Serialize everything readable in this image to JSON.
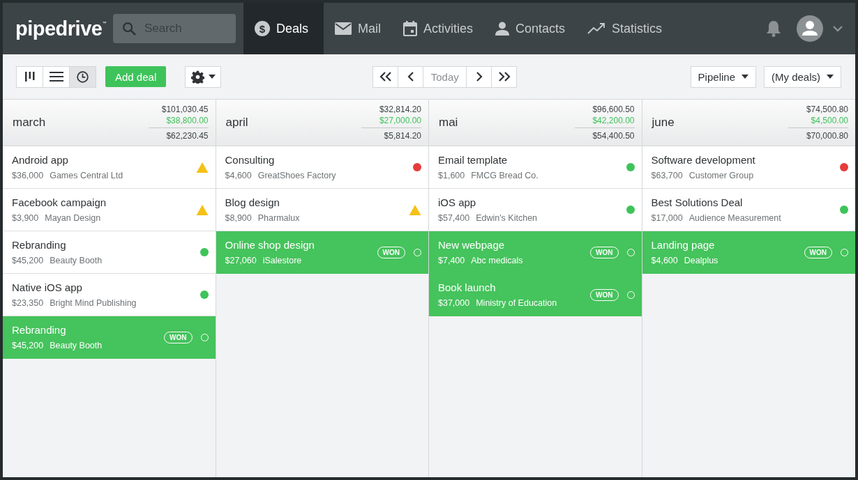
{
  "logo": "pipedrive$^{™}$",
  "search": {
    "placeholder": "Search"
  },
  "nav": [
    {
      "label": "Deals",
      "glyph": "$",
      "selected": true
    },
    {
      "label": "Mail",
      "selected": false
    },
    {
      "label": "Activities",
      "selected": false
    },
    {
      "label": "Contacts",
      "selected": false
    },
    {
      "label": "Statistics",
      "selected": false
    }
  ],
  "view_buttons": [
    {
      "selected": false
    },
    {
      "selected": false
    },
    {
      "selected": true
    }
  ],
  "add_button": "Add deal",
  "period_nav": {
    "today": "Today"
  },
  "filters": [
    {
      "label": "Pipeline"
    },
    {
      "label": "(My deals)"
    }
  ],
  "columns": [
    {
      "title": "march",
      "total": "$101,030.45",
      "won": "$38,800.00",
      "remaining": "$62,230.45",
      "deals": [
        {
          "name": "Android app",
          "value": "$36,000",
          "org": "Games Central Ltd",
          "kind": "warning"
        },
        {
          "name": "Facebook campaign",
          "value": "$3,900",
          "org": "Mayan Design",
          "kind": "warning"
        },
        {
          "name": "Rebranding",
          "value": "$45,200",
          "org": "Beauty Booth",
          "kind": "dot",
          "color": "#3ec35a"
        },
        {
          "name": "Native iOS app",
          "value": "$23,350",
          "org": "Bright Mind Publishing",
          "kind": "dot",
          "color": "#3ec35a"
        },
        {
          "name": "Rebranding",
          "value": "$45,200",
          "org": "Beauty Booth",
          "kind": "won",
          "badge": "WON"
        }
      ]
    },
    {
      "title": "april",
      "total": "$32,814.20",
      "won": "$27,000.00",
      "remaining": "$5,814.20",
      "deals": [
        {
          "name": "Consulting",
          "value": "$4,600",
          "org": "GreatShoes Factory",
          "kind": "dot",
          "color": "#e53c3c"
        },
        {
          "name": "Blog design",
          "value": "$8,900",
          "org": "Pharmalux",
          "kind": "warning"
        },
        {
          "name": "Online shop design",
          "value": "$27,060",
          "org": "iSalestore",
          "kind": "won",
          "badge": "WON"
        }
      ]
    },
    {
      "title": "mai",
      "total": "$96,600.50",
      "won": "$42,200.00",
      "remaining": "$54,400.50",
      "deals": [
        {
          "name": "Email template",
          "value": "$1,600",
          "org": "FMCG Bread Co.",
          "kind": "dot",
          "color": "#3ec35a"
        },
        {
          "name": "iOS app",
          "value": "$57,400",
          "org": "Edwin's Kitchen",
          "kind": "dot",
          "color": "#3ec35a"
        },
        {
          "name": "New webpage",
          "value": "$7,400",
          "org": "Abc medicals",
          "kind": "won",
          "badge": "WON"
        },
        {
          "name": "Book launch",
          "value": "$37,000",
          "org": "Ministry of Education",
          "kind": "won",
          "badge": "WON"
        }
      ]
    },
    {
      "title": "june",
      "total": "$74,500.80",
      "won": "$4,500.00",
      "remaining": "$70,000.80",
      "deals": [
        {
          "name": "Software development",
          "value": "$63,700",
          "org": "Customer Group",
          "kind": "dot",
          "color": "#e53c3c"
        },
        {
          "name": "Best Solutions Deal",
          "value": "$17,000",
          "org": "Audience Measurement",
          "kind": "dot",
          "color": "#3ec35a"
        },
        {
          "name": "Landing page",
          "value": "$4,600",
          "org": "Dealplus",
          "kind": "won",
          "badge": "WON"
        }
      ]
    }
  ]
}
